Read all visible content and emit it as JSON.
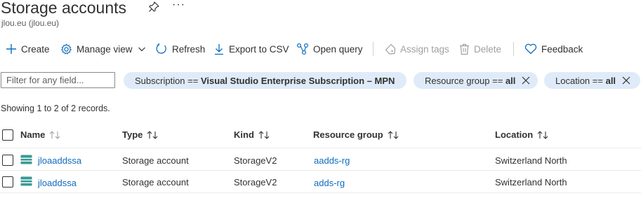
{
  "header": {
    "title": "Storage accounts",
    "subtitle": "jlou.eu (jlou.eu)",
    "more": "···"
  },
  "toolbar": {
    "create": "Create",
    "manage_view": "Manage view",
    "refresh": "Refresh",
    "export_csv": "Export to CSV",
    "open_query": "Open query",
    "assign_tags": "Assign tags",
    "delete": "Delete",
    "feedback": "Feedback"
  },
  "filters": {
    "placeholder": "Filter for any field...",
    "subscription": {
      "key": "Subscription",
      "op": "==",
      "value": "Visual Studio Enterprise Subscription – MPN"
    },
    "resource_group": {
      "key": "Resource group",
      "op": "==",
      "value": "all"
    },
    "location": {
      "key": "Location",
      "op": "==",
      "value": "all"
    }
  },
  "records": {
    "prefix": "Showing",
    "from": "1",
    "to_word": "to",
    "to": "2",
    "of_word": "of",
    "total": "2",
    "suffix": "records."
  },
  "table": {
    "columns": {
      "name": "Name",
      "type": "Type",
      "kind": "Kind",
      "resource_group": "Resource group",
      "location": "Location"
    },
    "rows": [
      {
        "name": "jloaaddssa",
        "type": "Storage account",
        "kind": "StorageV2",
        "resource_group": "aadds-rg",
        "location": "Switzerland North"
      },
      {
        "name": "jloaddssa",
        "type": "Storage account",
        "kind": "StorageV2",
        "resource_group": "adds-rg",
        "location": "Switzerland North"
      }
    ]
  },
  "colors": {
    "accent": "#0f6cbd",
    "pill": "#dfebf8",
    "text": "#323130",
    "disabled": "#a19f9d"
  },
  "icons": [
    "pin-icon",
    "more-icon",
    "plus-icon",
    "gear-icon",
    "chevron-down-icon",
    "refresh-icon",
    "download-icon",
    "query-icon",
    "tag-icon",
    "trash-icon",
    "heart-icon",
    "close-icon",
    "sort-icon",
    "storage-account-icon"
  ]
}
